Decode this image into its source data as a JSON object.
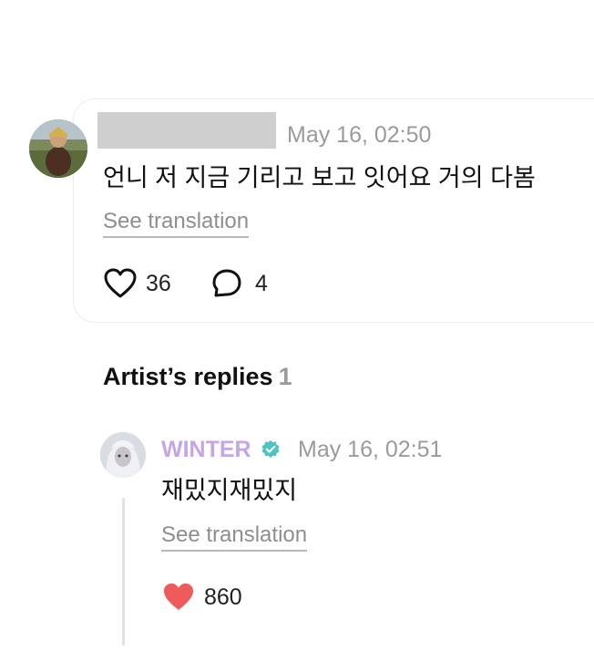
{
  "post": {
    "timestamp": "May 16, 02:50",
    "text": "언니 저 지금 기리고 보고 잇어요 거의 다봄",
    "see_translation": "See translation",
    "likes": "36",
    "comments": "4"
  },
  "artist_replies": {
    "heading": "Artist’s replies",
    "count": "1",
    "reply": {
      "author": "WINTER",
      "timestamp": "May 16, 02:51",
      "text": "재밌지재밌지",
      "see_translation": "See translation",
      "likes": "860"
    }
  },
  "icons": {
    "like": "heart-outline-icon",
    "comment": "comment-bubble-icon",
    "verified": "verified-badge-icon",
    "liked": "heart-filled-icon"
  },
  "colors": {
    "artist_name": "#c4a5e6",
    "verified_badge": "#4cc5c2",
    "liked_heart": "#ef5a5a",
    "muted_text": "#9b9b9b"
  }
}
